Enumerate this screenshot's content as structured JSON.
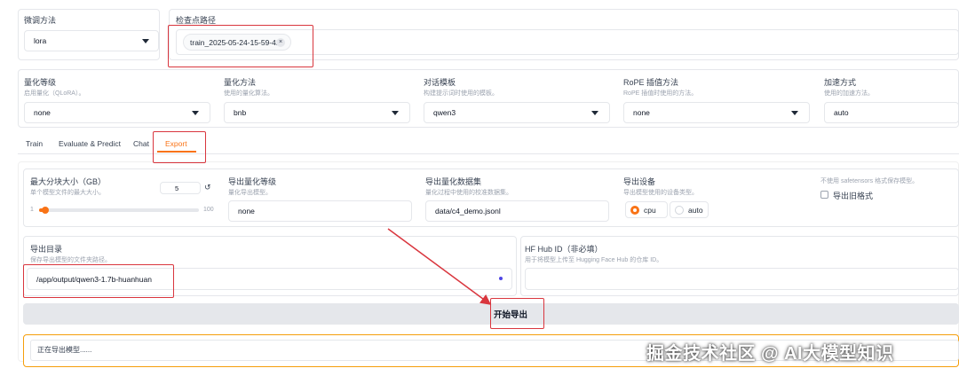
{
  "finetune": {
    "label": "微调方法",
    "value": "lora"
  },
  "checkpoint": {
    "label": "检查点路径",
    "chip": "train_2025-05-24-15-59-42",
    "remove": "×"
  },
  "row2": [
    {
      "label": "量化等级",
      "sub": "启用量化（QLoRA）。",
      "value": "none"
    },
    {
      "label": "量化方法",
      "sub": "使用的量化算法。",
      "value": "bnb"
    },
    {
      "label": "对话模板",
      "sub": "构建提示词时使用的模板。",
      "value": "qwen3"
    },
    {
      "label": "RoPE 插值方法",
      "sub": "RoPE 插值时使用的方法。",
      "value": "none"
    },
    {
      "label": "加速方式",
      "sub": "使用的加速方法。",
      "value": "auto"
    }
  ],
  "tabs": [
    "Train",
    "Evaluate & Predict",
    "Chat",
    "Export"
  ],
  "export": {
    "shard": {
      "label": "最大分块大小（GB）",
      "sub": "单个模型文件的最大大小。",
      "value": "5",
      "reset": "↺",
      "min": "1",
      "max": "100",
      "level": 0.04
    },
    "quant_bit": {
      "label": "导出量化等级",
      "sub": "量化导出模型。",
      "value": "none"
    },
    "quant_dataset": {
      "label": "导出量化数据集",
      "sub": "量化过程中使用的校准数据集。",
      "value": "data/c4_demo.jsonl"
    },
    "device": {
      "label": "导出设备",
      "sub": "导出模型使用的设备类型。",
      "options": [
        "cpu",
        "auto"
      ],
      "selected": "cpu"
    },
    "legacy": {
      "hint": "不使用 safetensors 格式保存模型。",
      "label": "导出旧格式"
    },
    "dir": {
      "label": "导出目录",
      "sub": "保存导出模型的文件夹路径。",
      "value": "/app/output/qwen3-1.7b-huanhuan"
    },
    "hub": {
      "label": "HF Hub ID（非必填）",
      "sub": "用于将模型上传至 Hugging Face Hub 的仓库 ID。",
      "value": ""
    },
    "button": "开始导出",
    "status": "正在导出模型......"
  },
  "watermark": "掘金技术社区 @ AI大模型知识",
  "colors": {
    "accent": "#f97316",
    "annotation": "#d9363e"
  }
}
